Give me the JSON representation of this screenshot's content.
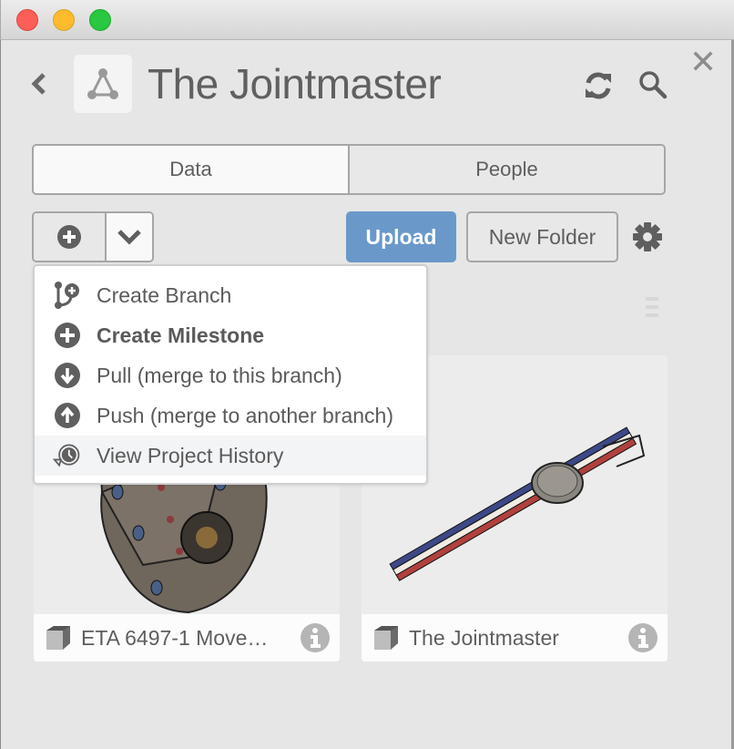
{
  "window": {
    "traffic_lights": [
      "close",
      "minimize",
      "zoom"
    ]
  },
  "header": {
    "title": "The Jointmaster",
    "back_icon": "chevron-left-icon",
    "logo_icon": "project-triangle-icon",
    "sync_icon": "refresh-icon",
    "search_icon": "search-icon",
    "close_icon": "close-icon"
  },
  "tabs": [
    {
      "label": "Data",
      "active": true
    },
    {
      "label": "People",
      "active": false
    }
  ],
  "toolbar": {
    "add_icon": "plus-circle-icon",
    "dropdown_icon": "chevron-down-icon",
    "upload_label": "Upload",
    "new_folder_label": "New Folder",
    "settings_icon": "gear-icon"
  },
  "colors": {
    "accent": "#6a99c9",
    "text": "#5e5e5e",
    "background": "#e6e6e6",
    "menu_hover": "#f3f4f6"
  },
  "dropdown_menu": {
    "items": [
      {
        "label": "Create Branch",
        "icon": "branch-plus-icon",
        "bold": false,
        "hovered": false
      },
      {
        "label": "Create Milestone",
        "icon": "plus-circle-icon",
        "bold": true,
        "hovered": false
      },
      {
        "label": "Pull (merge to this branch)",
        "icon": "arrow-down-circle-icon",
        "bold": false,
        "hovered": false
      },
      {
        "label": "Push (merge to another branch)",
        "icon": "arrow-up-circle-icon",
        "bold": false,
        "hovered": false
      },
      {
        "label": "View Project History",
        "icon": "history-icon",
        "bold": false,
        "hovered": true
      }
    ]
  },
  "files": [
    {
      "name": "ETA 6497-1 Move…",
      "type_icon": "cube-icon",
      "thumbnail": "watch-movement-render",
      "info_icon": "info-icon"
    },
    {
      "name": "The Jointmaster",
      "type_icon": "cube-icon",
      "thumbnail": "watch-strap-render",
      "info_icon": "info-icon"
    }
  ]
}
